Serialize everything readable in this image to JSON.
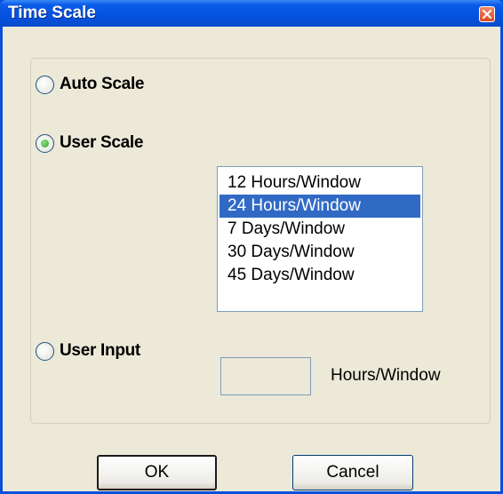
{
  "window": {
    "title": "Time Scale"
  },
  "options": {
    "auto_scale": {
      "label": "Auto Scale",
      "selected": false
    },
    "user_scale": {
      "label": "User Scale",
      "selected": true
    },
    "user_input": {
      "label": "User Input",
      "selected": false
    }
  },
  "scale_list": {
    "items": [
      "12 Hours/Window",
      "24 Hours/Window",
      "7 Days/Window",
      "30 Days/Window",
      "45 Days/Window"
    ],
    "selected": "24 Hours/Window"
  },
  "user_input": {
    "value": "",
    "unit_label": "Hours/Window"
  },
  "buttons": {
    "ok": "OK",
    "cancel": "Cancel"
  },
  "colors": {
    "selection": "#316AC5",
    "titlebar": "#0553E1",
    "dialog_bg": "#ECE9D8"
  }
}
